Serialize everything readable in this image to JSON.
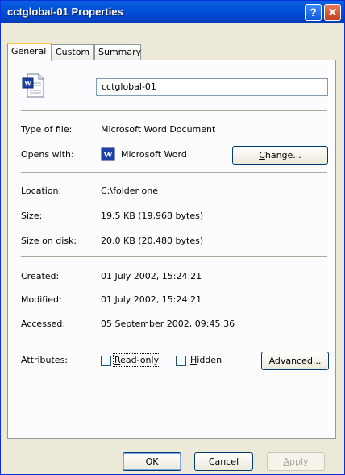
{
  "window": {
    "title": "cctglobal-01 Properties",
    "help_glyph": "?",
    "close_glyph": "✕"
  },
  "tabs": [
    {
      "label": "General",
      "active": true
    },
    {
      "label": "Custom",
      "active": false
    },
    {
      "label": "Summary",
      "active": false
    }
  ],
  "general": {
    "file_icon": "word-document-icon",
    "file_name": "cctglobal-01",
    "type_label": "Type of file:",
    "type_value": "Microsoft Word Document",
    "opens_label": "Opens with:",
    "opens_icon": "word-app-icon",
    "opens_value": "Microsoft Word",
    "change_button": {
      "pre": "",
      "key": "C",
      "post": "hange..."
    },
    "location_label": "Location:",
    "location_value": "C:\\folder one",
    "size_label": "Size:",
    "size_value": "19.5 KB (19,968 bytes)",
    "size_on_disk_label": "Size on disk:",
    "size_on_disk_value": "20.0 KB (20,480 bytes)",
    "created_label": "Created:",
    "created_value": "01 July 2002, 15:24:21",
    "modified_label": "Modified:",
    "modified_value": "01 July 2002, 15:24:21",
    "accessed_label": "Accessed:",
    "accessed_value": "05 September 2002, 09:45:36",
    "attributes_label": "Attributes:",
    "readonly": {
      "key": "R",
      "rest": "ead-only",
      "checked": false
    },
    "hidden": {
      "key": "H",
      "rest": "idden",
      "checked": false
    },
    "advanced_button": {
      "pre": "A",
      "key": "d",
      "post": "vanced..."
    }
  },
  "footer": {
    "ok": "OK",
    "cancel": "Cancel",
    "apply": {
      "key": "A",
      "rest": "pply"
    }
  },
  "colors": {
    "titlebar": "#0050d8",
    "dialog_bg": "#ece9d8",
    "tab_highlight": "#ffc83c",
    "word_blue": "#1c3fa8"
  }
}
